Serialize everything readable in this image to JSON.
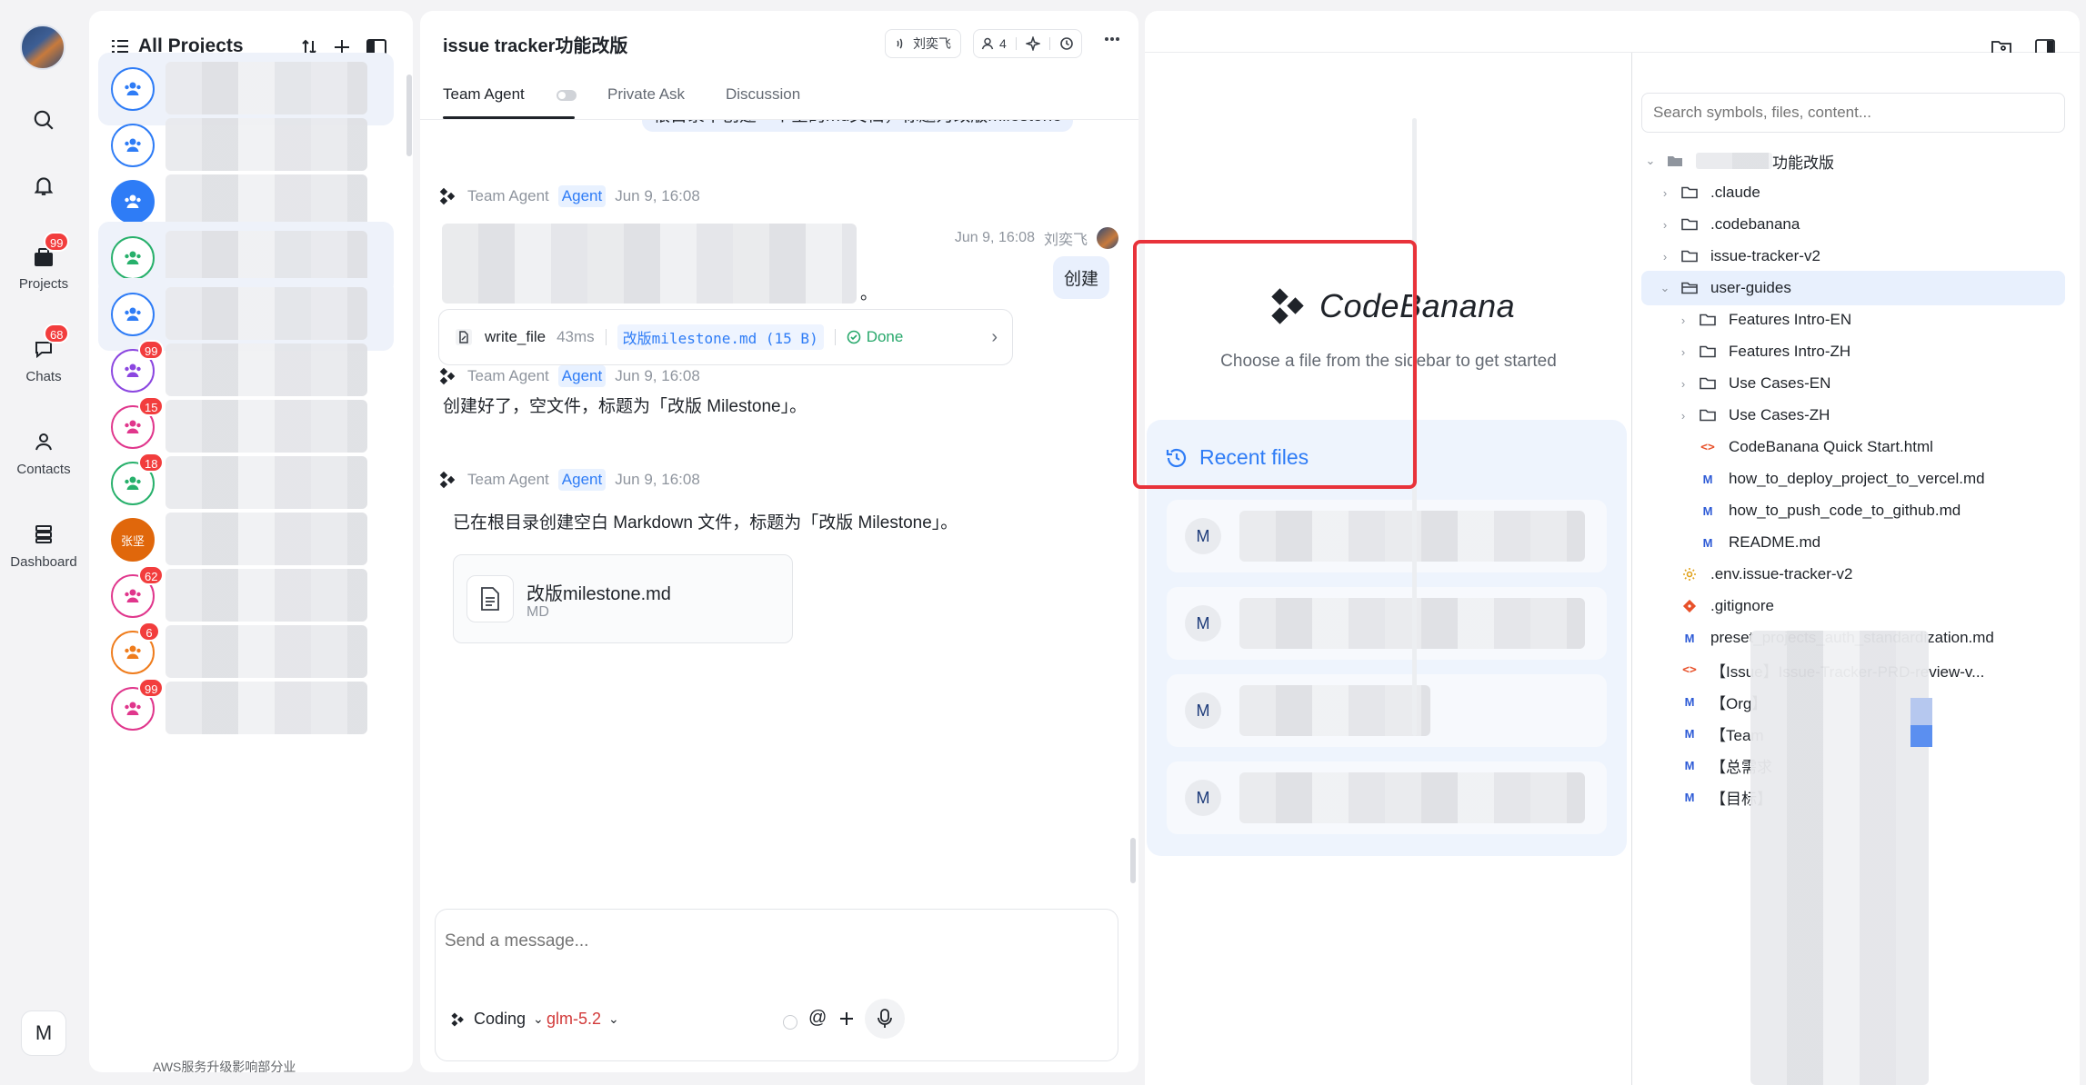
{
  "nav": {
    "items": [
      {
        "id": "search",
        "label": ""
      },
      {
        "id": "notifications",
        "label": ""
      },
      {
        "id": "projects",
        "label": "Projects",
        "badge": "99"
      },
      {
        "id": "chats",
        "label": "Chats",
        "badge": "68"
      },
      {
        "id": "contacts",
        "label": "Contacts"
      },
      {
        "id": "dashboard",
        "label": "Dashboard"
      }
    ],
    "bottom_initial": "M"
  },
  "projects": {
    "title": "All Projects",
    "items": [
      {
        "color": "blue",
        "badge": ""
      },
      {
        "color": "blue",
        "badge": ""
      },
      {
        "color": "blue-fill",
        "badge": ""
      },
      {
        "color": "green",
        "badge": ""
      },
      {
        "color": "blue",
        "badge": ""
      },
      {
        "color": "purple",
        "badge": "99"
      },
      {
        "color": "pink",
        "badge": "15"
      },
      {
        "color": "green",
        "badge": "18"
      },
      {
        "color": "person",
        "badge": "",
        "initials": "张坚"
      },
      {
        "color": "pink",
        "badge": "62"
      },
      {
        "color": "orange",
        "badge": "6"
      },
      {
        "color": "pink",
        "badge": "99"
      }
    ],
    "partial_bottom_text": "AWS服务升级影响部分业"
  },
  "chat": {
    "title": "issue tracker功能改版",
    "header": {
      "user": "刘奕飞",
      "members": "4"
    },
    "tabs": [
      "Team Agent",
      "Private Ask",
      "Discussion"
    ],
    "top_bubble": "根目录下创建一个空的md文档，标题为改版milestone",
    "messages": [
      {
        "sender": "Team Agent",
        "tag": "Agent",
        "time": "Jun 9, 16:08",
        "trailing": "。"
      },
      {
        "user_time": "Jun 9, 16:08",
        "user": "刘奕飞",
        "text": "创建"
      },
      {
        "tool": "write_file",
        "duration": "43ms",
        "file": "改版milestone.md (15 B)",
        "status": "Done"
      },
      {
        "sender": "Team Agent",
        "tag": "Agent",
        "time": "Jun 9, 16:08",
        "text": "创建好了，空文件，标题为「改版 Milestone」。"
      },
      {
        "sender": "Team Agent",
        "tag": "Agent",
        "time": "Jun 9, 16:08",
        "text": "已在根目录创建空白 Markdown 文件，标题为「改版 Milestone」。"
      }
    ],
    "file_card": {
      "name": "改版milestone.md",
      "type": "MD"
    },
    "composer": {
      "placeholder": "Send a message...",
      "mode": "Coding",
      "model": "glm-5.2"
    }
  },
  "editor": {
    "logo": "CodeBanana",
    "hint": "Choose a file from the sidebar to get started",
    "recent_title": "Recent files",
    "recent_items": [
      "M",
      "M",
      "M",
      "M"
    ]
  },
  "tree": {
    "search_placeholder": "Search symbols, files, content...",
    "root_suffix": "功能改版",
    "rows": [
      {
        "depth": 1,
        "type": "folder",
        "name": ".claude",
        "chev": "›"
      },
      {
        "depth": 1,
        "type": "folder",
        "name": ".codebanana",
        "chev": "›"
      },
      {
        "depth": 1,
        "type": "folder",
        "name": "issue-tracker-v2",
        "chev": "›"
      },
      {
        "depth": 1,
        "type": "folder-open",
        "name": "user-guides",
        "chev": "⌄",
        "selected": true
      },
      {
        "depth": 2,
        "type": "folder",
        "name": "Features Intro-EN",
        "chev": "›"
      },
      {
        "depth": 2,
        "type": "folder",
        "name": "Features Intro-ZH",
        "chev": "›"
      },
      {
        "depth": 2,
        "type": "folder",
        "name": "Use Cases-EN",
        "chev": "›"
      },
      {
        "depth": 2,
        "type": "folder",
        "name": "Use Cases-ZH",
        "chev": "›"
      },
      {
        "depth": 2,
        "type": "html",
        "name": "CodeBanana Quick Start.html",
        "chev": ""
      },
      {
        "depth": 2,
        "type": "md",
        "name": "how_to_deploy_project_to_vercel.md",
        "chev": ""
      },
      {
        "depth": 2,
        "type": "md",
        "name": "how_to_push_code_to_github.md",
        "chev": ""
      },
      {
        "depth": 2,
        "type": "md",
        "name": "README.md",
        "chev": ""
      },
      {
        "depth": 1,
        "type": "env",
        "name": ".env.issue-tracker-v2",
        "chev": ""
      },
      {
        "depth": 1,
        "type": "git",
        "name": ".gitignore",
        "chev": ""
      },
      {
        "depth": 1,
        "type": "md",
        "name": "preset_projects_auth_standardization.md",
        "chev": ""
      },
      {
        "depth": 1,
        "type": "html",
        "name": "【Issue】Issue-Tracker-PRD-review-v...",
        "chev": ""
      },
      {
        "depth": 1,
        "type": "md",
        "name": "【Org】",
        "chev": ""
      },
      {
        "depth": 1,
        "type": "md",
        "name": "【Team",
        "chev": ""
      },
      {
        "depth": 1,
        "type": "md",
        "name": "【总需求",
        "chev": ""
      },
      {
        "depth": 1,
        "type": "md",
        "name": "【目标】",
        "chev": ""
      }
    ]
  },
  "colors": {
    "accent": "#2e7cf6",
    "badge": "#f23d3d",
    "highlight_box": "#e8323a",
    "done": "#27a86b"
  }
}
